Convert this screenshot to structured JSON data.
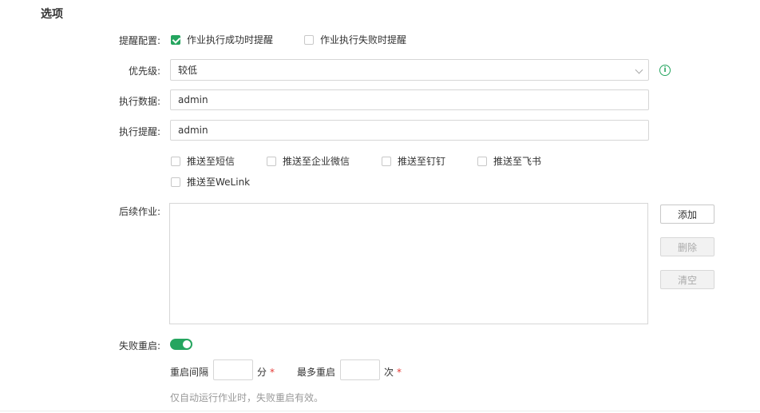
{
  "section": {
    "title": "选项"
  },
  "reminder": {
    "label": "提醒配置:",
    "success": {
      "label": "作业执行成功时提醒",
      "checked": true
    },
    "failure": {
      "label": "作业执行失败时提醒",
      "checked": false
    }
  },
  "priority": {
    "label": "优先级:",
    "value": "较低",
    "info_icon": "info-icon"
  },
  "exec_data": {
    "label": "执行数据:",
    "value": "admin"
  },
  "exec_remind": {
    "label": "执行提醒:",
    "value": "admin"
  },
  "push": {
    "sms": "推送至短信",
    "wechat_work": "推送至企业微信",
    "dingtalk": "推送至钉钉",
    "feishu": "推送至飞书",
    "welink": "推送至WeLink"
  },
  "follow_jobs": {
    "label": "后续作业:",
    "add": "添加",
    "delete": "删除",
    "clear": "清空"
  },
  "retry": {
    "label": "失败重启:",
    "enabled": true,
    "interval_label": "重启间隔",
    "interval_unit": "分",
    "max_label": "最多重启",
    "max_unit": "次",
    "required_mark": "*",
    "hint": "仅自动运行作业时，失败重启有效。"
  },
  "colors": {
    "accent": "#25a55f",
    "required": "#e53935"
  }
}
